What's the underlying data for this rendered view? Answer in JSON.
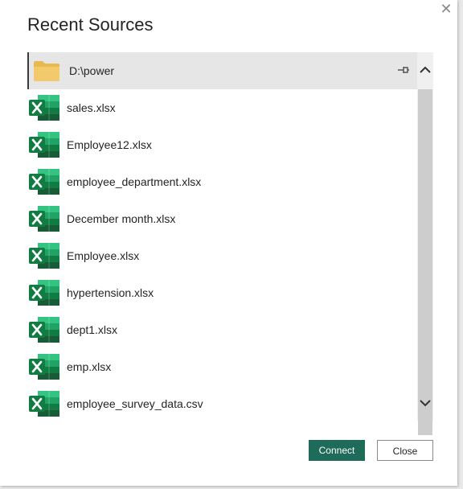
{
  "dialog": {
    "title": "Recent Sources",
    "close_glyph": "✕"
  },
  "sources": [
    {
      "label": "D:\\power",
      "icon": "folder-icon",
      "selected": true,
      "pinned": true
    },
    {
      "label": "sales.xlsx",
      "icon": "excel-icon"
    },
    {
      "label": "Employee12.xlsx",
      "icon": "excel-icon"
    },
    {
      "label": "employee_department.xlsx",
      "icon": "excel-icon"
    },
    {
      "label": "December month.xlsx",
      "icon": "excel-icon"
    },
    {
      "label": "Employee.xlsx",
      "icon": "excel-icon"
    },
    {
      "label": "hypertension.xlsx",
      "icon": "excel-icon"
    },
    {
      "label": "dept1.xlsx",
      "icon": "excel-icon"
    },
    {
      "label": "emp.xlsx",
      "icon": "excel-icon"
    },
    {
      "label": "employee_survey_data.csv",
      "icon": "excel-icon"
    }
  ],
  "buttons": {
    "connect": "Connect",
    "close": "Close"
  },
  "colors": {
    "accent": "#1f6b5a",
    "excel_green": "#107c41",
    "folder": "#f2c96b"
  }
}
